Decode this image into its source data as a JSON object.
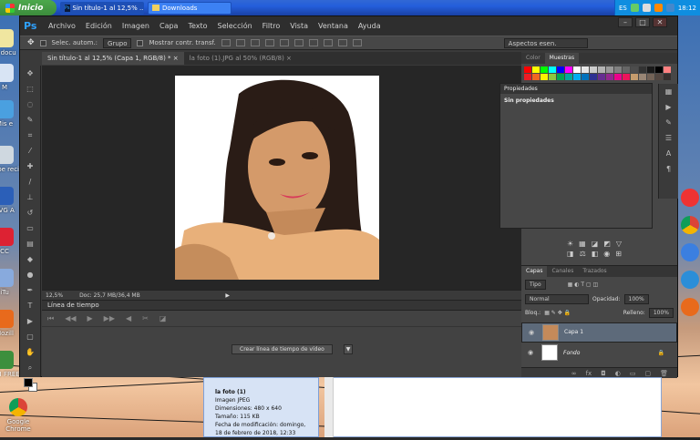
{
  "taskbar": {
    "start_label": "Inicio",
    "tasks": [
      {
        "label": "Sin título-1 al 12,5% ..."
      },
      {
        "label": "Downloads"
      }
    ],
    "lang": "ES",
    "clock": "18:12"
  },
  "desktop_icons": [
    {
      "label": "M docu"
    },
    {
      "label": "M"
    },
    {
      "label": "Mis e"
    },
    {
      "label": "Pape reci"
    },
    {
      "label": "AVG A"
    },
    {
      "label": "CC"
    },
    {
      "label": "iTu"
    },
    {
      "label": "Mozill"
    },
    {
      "label": "BS.I FREE"
    },
    {
      "label": "Google Chrome"
    }
  ],
  "photoshop": {
    "logo": "Ps",
    "menu": [
      "Archivo",
      "Edición",
      "Imagen",
      "Capa",
      "Texto",
      "Selección",
      "Filtro",
      "Vista",
      "Ventana",
      "Ayuda"
    ],
    "window_controls": [
      "–",
      "□",
      "✕"
    ],
    "options": {
      "autoselect_label": "Selec. autom.:",
      "group_value": "Grupo",
      "transform_label": "Mostrar contr. transf.",
      "workspace_value": "Aspectos esen."
    },
    "doc_tabs": [
      {
        "label": "Sin título-1 al 12,5% (Capa 1, RGB/8) *",
        "close": "×"
      },
      {
        "label": "la foto (1).JPG al 50% (RGB/8)",
        "close": "×"
      }
    ],
    "status": {
      "zoom": "12,5%",
      "doc": "Doc: 25,7 MB/36,4 MB"
    },
    "timeline": {
      "title": "Línea de tiempo",
      "create_button": "Crear línea de tiempo de vídeo"
    },
    "panels": {
      "color_tab": "Color",
      "swatches_tab": "Muestras",
      "properties_title": "Propiedades",
      "properties_text": "Sin propiedades",
      "layer_tabs": [
        "Capas",
        "Canales",
        "Trazados"
      ],
      "kind_value": "Tipo",
      "blend_mode": "Normal",
      "opacity_label": "Opacidad:",
      "opacity_value": "100%",
      "lock_label": "Bloq.:",
      "fill_label": "Relleno:",
      "fill_value": "100%",
      "layers": [
        {
          "name": "Capa 1",
          "selected": true
        },
        {
          "name": "Fondo",
          "selected": false
        }
      ]
    },
    "swatch_colors": [
      "#ff0000",
      "#ffff00",
      "#00ff00",
      "#00ffff",
      "#0000ff",
      "#ff00ff",
      "#ffffff",
      "#e6e6e6",
      "#cccccc",
      "#b3b3b3",
      "#999999",
      "#808080",
      "#666666",
      "#4d4d4d",
      "#333333",
      "#1a1a1a",
      "#000000",
      "#ff8080",
      "#ed1c24",
      "#f26522",
      "#fff200",
      "#8dc63f",
      "#00a651",
      "#00a99d",
      "#00aeef",
      "#0072bc",
      "#2e3192",
      "#662d91",
      "#92278f",
      "#ec008c",
      "#ed145b",
      "#c69c6d",
      "#998675",
      "#736357",
      "#534741",
      "#362f2d"
    ]
  },
  "file_tip": {
    "name": "la foto (1)",
    "type": "Imagen JPEG",
    "dims": "Dimensiones: 480 x 640",
    "size": "Tamaño: 115 KB",
    "date": "Fecha de modificación: domingo, 18 de febrero de 2018, 12:33"
  }
}
